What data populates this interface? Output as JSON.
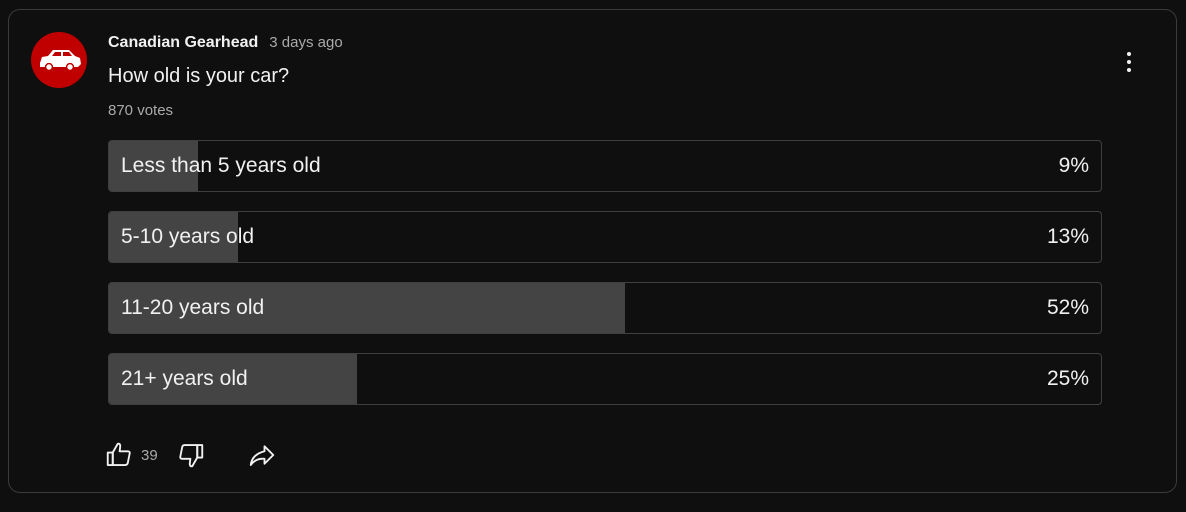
{
  "post": {
    "channel_name": "Canadian Gearhead",
    "timestamp": "3 days ago",
    "avatar_icon": "car-icon",
    "avatar_color": "#c00000"
  },
  "poll": {
    "question": "How old is your car?",
    "votes_text": "870 votes",
    "options": [
      {
        "label": "Less than 5 years old",
        "percent_text": "9%",
        "percent": 9
      },
      {
        "label": "5-10 years old",
        "percent_text": "13%",
        "percent": 13
      },
      {
        "label": "11-20 years old",
        "percent_text": "52%",
        "percent": 52
      },
      {
        "label": "21+ years old",
        "percent_text": "25%",
        "percent": 25
      }
    ]
  },
  "actions": {
    "like_count": "39",
    "like_icon": "thumbs-up-icon",
    "dislike_icon": "thumbs-down-icon",
    "share_icon": "share-icon",
    "more_icon": "more-vertical-icon"
  }
}
